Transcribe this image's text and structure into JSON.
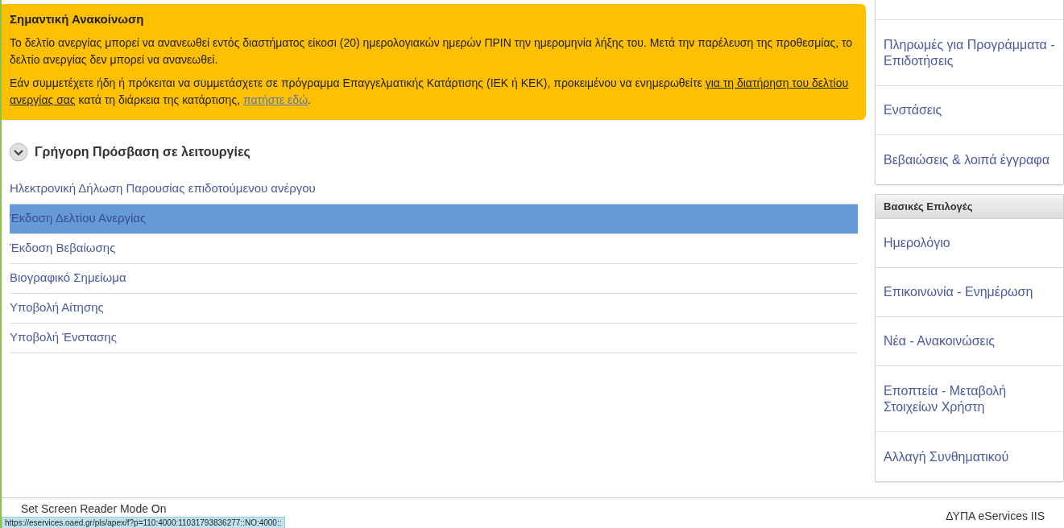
{
  "notice": {
    "title": "Σημαντική Ανακοίνωση",
    "paragraphs": [
      {
        "parts": [
          {
            "text": "Το δελτίο ανεργίας μπορεί να ανανεωθεί εντός διαστήματος είκοσι (20) ημερολογιακών ημερών ΠΡΙΝ την ημερομηνία λήξης του. Μετά την παρέλευση της προθεσμίας, το δελτίο ανεργίας δεν μπορεί να ανανεωθεί.",
            "kind": "text"
          }
        ]
      },
      {
        "parts": [
          {
            "text": "Εάν συμμετέχετε ήδη ή πρόκειται να συμμετάσχετε σε πρόγραμμα Επαγγελματικής Κατάρτισης (ΙΕΚ ή ΚΕΚ), προκειμένου να ενημερωθείτε ",
            "kind": "text"
          },
          {
            "text": "για τη διατήρηση του δελτίου ανεργίας σας",
            "kind": "underline"
          },
          {
            "text": " κατά τη διάρκεια της κατάρτισης, ",
            "kind": "text"
          },
          {
            "text": "πατήστε εδώ",
            "kind": "link"
          },
          {
            "text": ".",
            "kind": "text"
          }
        ]
      }
    ]
  },
  "quick_access": {
    "title": "Γρήγορη Πρόσβαση σε λειτουργίες",
    "expanded": true,
    "items": [
      {
        "label": "Ηλεκτρονική Δήλωση Παρουσίας επιδοτούμενου ανέργου",
        "selected": false
      },
      {
        "label": "Έκδοση Δελτίου Ανεργίας",
        "selected": true
      },
      {
        "label": "Έκδοση Βεβαίωσης",
        "selected": false
      },
      {
        "label": "Βιογραφικό Σημείωμα",
        "selected": false
      },
      {
        "label": "Υποβολή Αίτησης",
        "selected": false
      },
      {
        "label": "Υποβολή Ένστασης",
        "selected": false
      }
    ]
  },
  "sidebar": {
    "panels": [
      {
        "items": [
          "Πληρωμές για Προγράμματα - Επιδοτήσεις",
          "Ενστάσεις",
          "Βεβαιώσεις & λοιπά έγγραφα"
        ]
      },
      {
        "title": "Βασικές Επιλογές",
        "items": [
          "Ημερολόγιο",
          "Επικοινωνία - Ενημέρωση",
          "Νέα - Ανακοινώσεις",
          "Εποπτεία - Μεταβολή Στοιχείων Χρήστη",
          "Αλλαγή Συνθηματικού"
        ]
      }
    ]
  },
  "footer": {
    "left": "Set Screen Reader Mode On",
    "right": "ΔΥΠΑ eServices IIS"
  },
  "status_bar": {
    "url": "https://eservices.oaed.gr/pls/apex/f?p=110:4000:11031793836277::NO:4000::"
  }
}
